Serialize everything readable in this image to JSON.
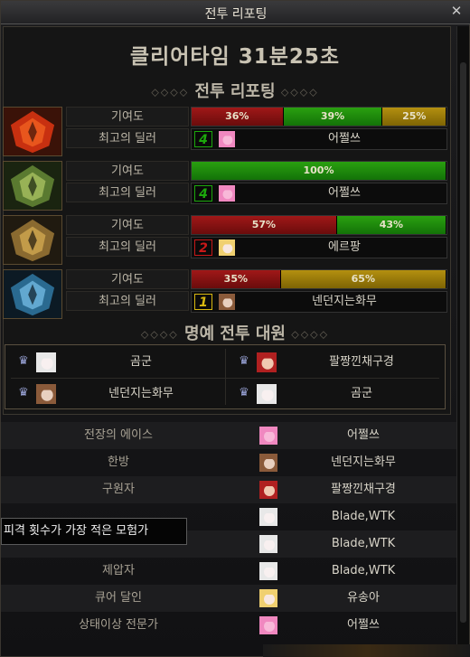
{
  "window": {
    "title": "전투 리포팅",
    "close_icon": "close-icon"
  },
  "clear_time": "클리어타임  31분25초",
  "section_report": "전투 리포팅",
  "section_honor": "명예 전투 대원",
  "labels": {
    "contribution": "기여도",
    "best_dealer": "최고의 딜러"
  },
  "parties": [
    {
      "emblem": "flame-emblem-icon",
      "contribution": [
        {
          "label": "36%",
          "percent": 36,
          "color": "red"
        },
        {
          "label": "39%",
          "percent": 39,
          "color": "green"
        },
        {
          "label": "25%",
          "percent": 25,
          "color": "yellow"
        }
      ],
      "best_dealer": {
        "rank": "4",
        "rank_color": "#1ca80c",
        "avatar": "pink-avatar-icon",
        "name": "어쩔쓰"
      }
    },
    {
      "emblem": "green-thorn-emblem-icon",
      "contribution": [
        {
          "label": "100%",
          "percent": 100,
          "color": "green"
        }
      ],
      "best_dealer": {
        "rank": "4",
        "rank_color": "#1ca80c",
        "avatar": "pink-avatar-icon",
        "name": "어쩔쓰"
      }
    },
    {
      "emblem": "gold-knight-emblem-icon",
      "contribution": [
        {
          "label": "57%",
          "percent": 57,
          "color": "red"
        },
        {
          "label": "43%",
          "percent": 43,
          "color": "green"
        }
      ],
      "best_dealer": {
        "rank": "2",
        "rank_color": "#c81818",
        "avatar": "blonde-avatar-icon",
        "name": "에르팡"
      }
    },
    {
      "emblem": "ice-emblem-icon",
      "contribution": [
        {
          "label": "35%",
          "percent": 35,
          "color": "red"
        },
        {
          "label": "65%",
          "percent": 65,
          "color": "yellow"
        }
      ],
      "best_dealer": {
        "rank": "1",
        "rank_color": "#d8b810",
        "avatar": "brown-avatar-icon",
        "name": "넨던지는화무"
      }
    }
  ],
  "honor_members": [
    {
      "avatar": "white-avatar-icon",
      "name": "곰군"
    },
    {
      "avatar": "red-avatar-icon",
      "name": "팔짱낀채구경"
    },
    {
      "avatar": "brown-avatar-icon",
      "name": "넨던지는화무"
    },
    {
      "avatar": "white-avatar-icon",
      "name": "곰군"
    }
  ],
  "awards": [
    {
      "title": "전장의 에이스",
      "avatar": "pink-avatar-icon",
      "name": "어쩔쓰"
    },
    {
      "title": "한방",
      "avatar": "brown-avatar-icon",
      "name": "넨던지는화무"
    },
    {
      "title": "구원자",
      "avatar": "red-avatar-icon",
      "name": "팔짱낀채구경"
    },
    {
      "title": "",
      "avatar": "white-avatar-icon",
      "name": "Blade,WTK"
    },
    {
      "title": "",
      "avatar": "white-avatar-icon",
      "name": "Blade,WTK"
    },
    {
      "title": "제압자",
      "avatar": "white-avatar-icon",
      "name": "Blade,WTK"
    },
    {
      "title": "큐어 달인",
      "avatar": "blonde-avatar-icon",
      "name": "유송아"
    },
    {
      "title": "상태이상 전문가",
      "avatar": "pink-avatar-icon",
      "name": "어쩔쓰"
    }
  ],
  "tooltip": "피격 횟수가 가장 적은 모험가",
  "colors": {
    "red": "#a01818",
    "green": "#2aa010",
    "yellow": "#b49010"
  }
}
